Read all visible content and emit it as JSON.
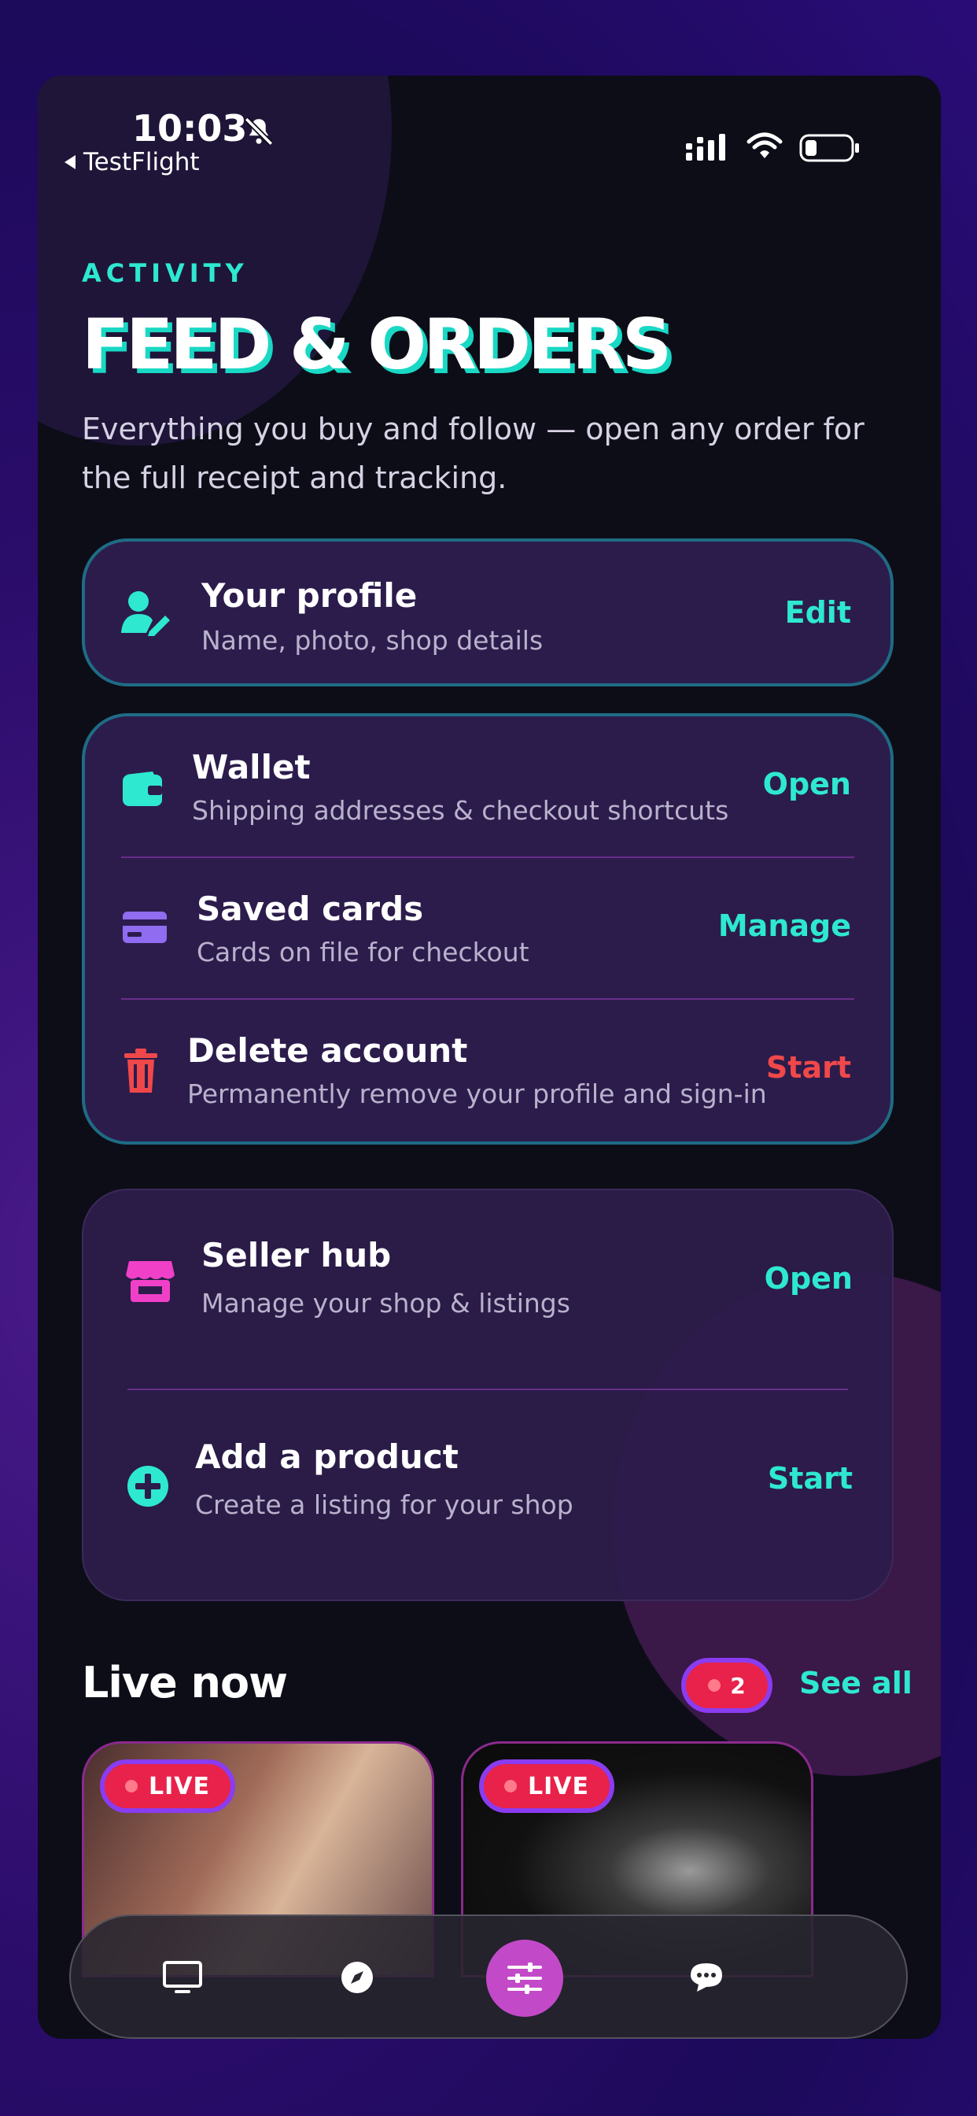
{
  "status_bar": {
    "time": "10:03",
    "back_label": "TestFlight"
  },
  "header": {
    "eyebrow": "ACTIVITY",
    "title": "FEED & ORDERS",
    "subtitle": "Everything you buy and follow — open any order for the full receipt and tracking."
  },
  "profile": {
    "title": "Your profile",
    "subtitle": "Name, photo, shop details",
    "action": "Edit",
    "icon": "user-edit-icon"
  },
  "account_items": [
    {
      "title": "Wallet",
      "subtitle": "Shipping addresses & checkout shortcuts",
      "action": "Open",
      "icon": "wallet-icon"
    },
    {
      "title": "Saved cards",
      "subtitle": "Cards on file for checkout",
      "action": "Manage",
      "icon": "credit-card-icon"
    },
    {
      "title": "Delete account",
      "subtitle": "Permanently remove your profile and sign-in",
      "action": "Start",
      "icon": "trash-icon"
    }
  ],
  "seller_items": [
    {
      "title": "Seller hub",
      "subtitle": "Manage your shop & listings",
      "action": "Open",
      "icon": "store-icon"
    },
    {
      "title": "Add a product",
      "subtitle": "Create a listing for your shop",
      "action": "Start",
      "icon": "plus-circle-icon"
    }
  ],
  "live_section": {
    "title": "Live now",
    "count": "2",
    "see_all": "See all",
    "streams": [
      {
        "badge": "LIVE"
      },
      {
        "badge": "LIVE"
      }
    ]
  },
  "tab_bar": {
    "tabs": [
      "monitor-icon",
      "compass-icon",
      "sliders-icon",
      "chat-bubble-icon"
    ],
    "active_tab": "sliders-icon"
  },
  "colors": {
    "accent": "#2ee8d0",
    "danger": "#f0484a",
    "live": "#e8224a",
    "card_bg": "#2c1c4c",
    "active_tab": "#c24ac8"
  }
}
